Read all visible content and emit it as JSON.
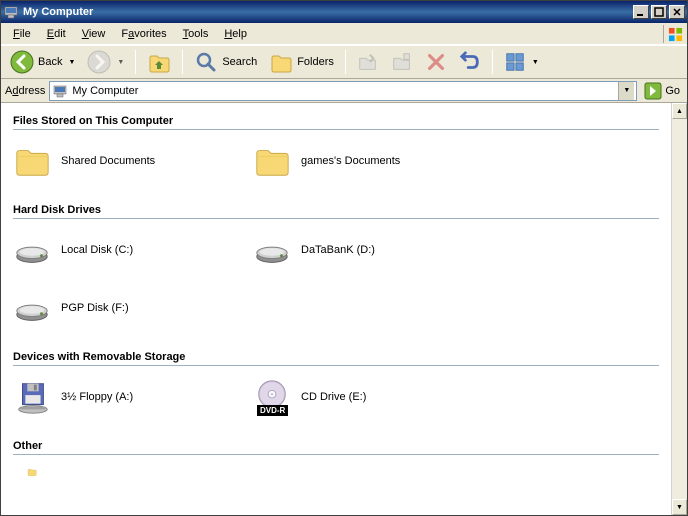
{
  "window": {
    "title": "My Computer"
  },
  "menubar": {
    "file": "File",
    "edit": "Edit",
    "view": "View",
    "favorites": "Favorites",
    "tools": "Tools",
    "help": "Help"
  },
  "toolbar": {
    "back": "Back",
    "search": "Search",
    "folders": "Folders"
  },
  "addressbar": {
    "label": "Address",
    "value": "My Computer",
    "go": "Go"
  },
  "groups": {
    "files_stored": {
      "header": "Files Stored on This Computer"
    },
    "hard_disks": {
      "header": "Hard Disk Drives"
    },
    "removable": {
      "header": "Devices with Removable Storage"
    },
    "other": {
      "header": "Other"
    }
  },
  "items": {
    "shared_docs": "Shared Documents",
    "games_docs": "games's Documents",
    "local_disk": "Local Disk (C:)",
    "databank": "DaTaBanK (D:)",
    "pgp_disk": "PGP Disk (F:)",
    "floppy": "3½ Floppy (A:)",
    "cd_drive": "CD Drive (E:)",
    "cd_badge": "DVD-R"
  }
}
